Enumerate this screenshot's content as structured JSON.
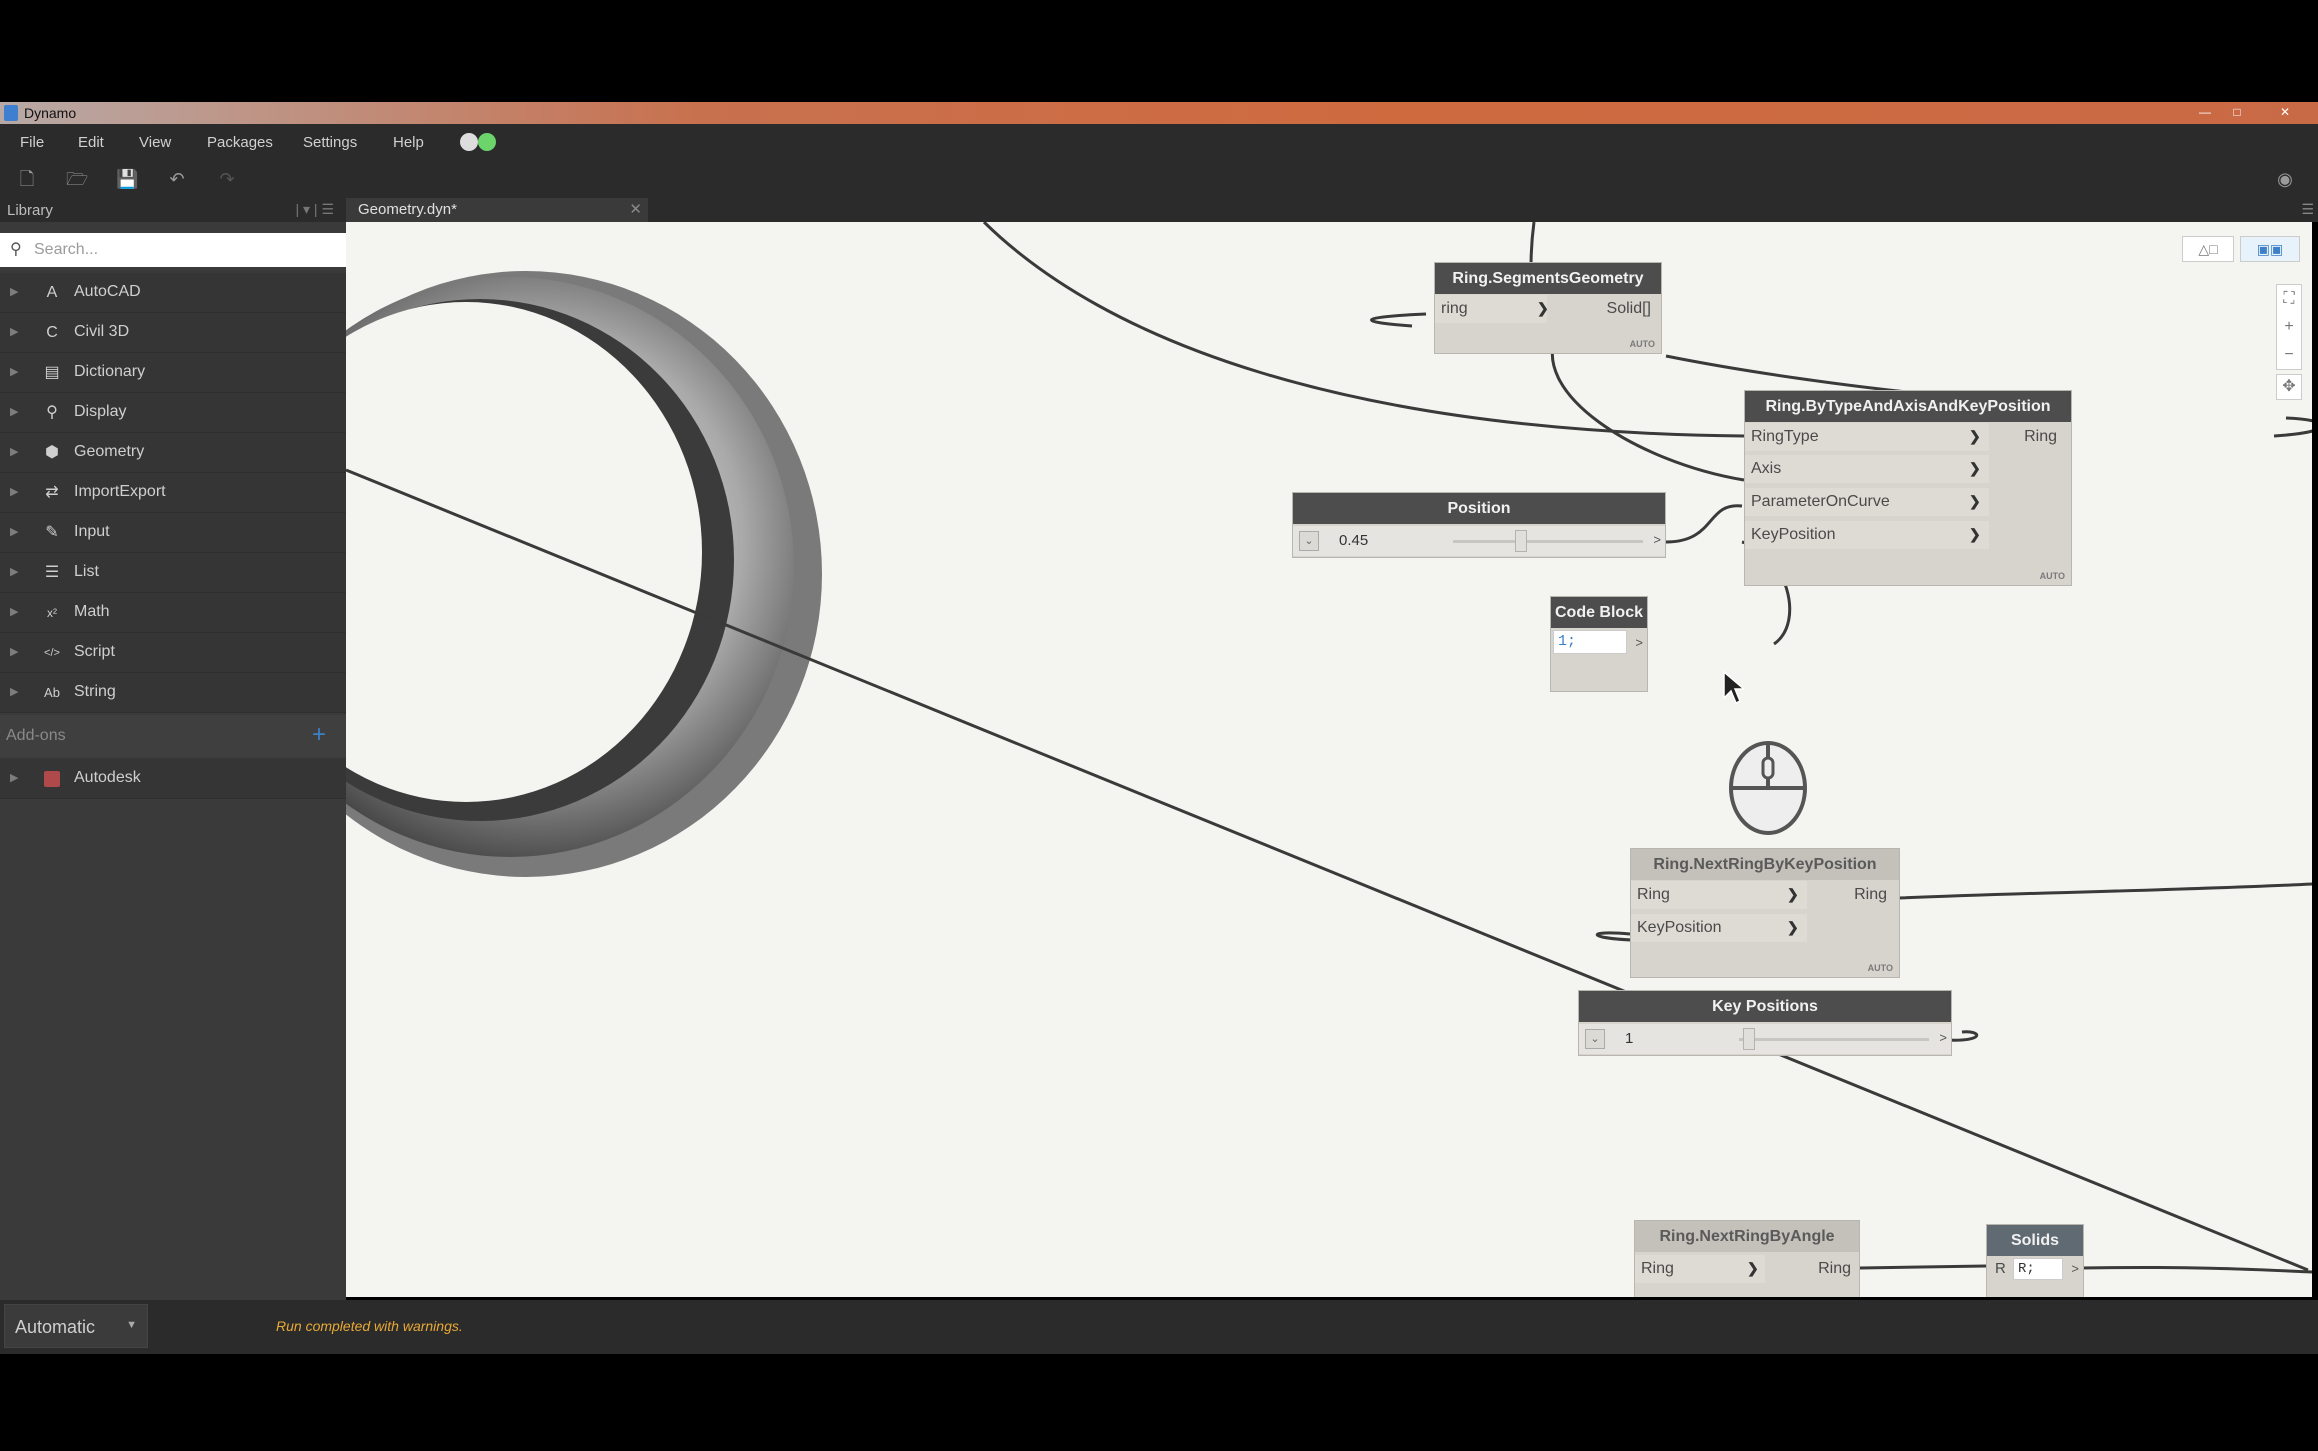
{
  "window": {
    "title": "Dynamo"
  },
  "menu": [
    "File",
    "Edit",
    "View",
    "Packages",
    "Settings",
    "Help"
  ],
  "library": {
    "title": "Library",
    "search_placeholder": "Search...",
    "categories": [
      {
        "label": "AutoCAD",
        "icon": "A"
      },
      {
        "label": "Civil 3D",
        "icon": "C"
      },
      {
        "label": "Dictionary",
        "icon": "▤"
      },
      {
        "label": "Display",
        "icon": "⚲"
      },
      {
        "label": "Geometry",
        "icon": "⬢"
      },
      {
        "label": "ImportExport",
        "icon": "⇄"
      },
      {
        "label": "Input",
        "icon": "✎"
      },
      {
        "label": "List",
        "icon": "☰"
      },
      {
        "label": "Math",
        "icon": "x²"
      },
      {
        "label": "Script",
        "icon": "</>"
      },
      {
        "label": "String",
        "icon": "Ab"
      }
    ],
    "addons_label": "Add-ons",
    "addon_items": [
      {
        "label": "Autodesk"
      }
    ]
  },
  "tab": {
    "label": "Geometry.dyn*"
  },
  "nodes": {
    "segments": {
      "title": "Ring.SegmentsGeometry",
      "in": "ring",
      "out": "Solid[]",
      "badge": "AUTO"
    },
    "bytype": {
      "title": "Ring.ByTypeAndAxisAndKeyPosition",
      "inputs": [
        "RingType",
        "Axis",
        "ParameterOnCurve",
        "KeyPosition"
      ],
      "out": "Ring",
      "badge": "AUTO"
    },
    "position": {
      "title": "Position",
      "value": "0.45",
      "out": ">",
      "fraction": 0.45
    },
    "codeblock": {
      "title": "Code Block",
      "code": "1;",
      "out": ">"
    },
    "nextkey": {
      "title": "Ring.NextRingByKeyPosition",
      "inputs": [
        "Ring",
        "KeyPosition"
      ],
      "out": "Ring",
      "badge": "AUTO"
    },
    "keypositions": {
      "title": "Key Positions",
      "value": "1",
      "out": ">"
    },
    "nextangle": {
      "title": "Ring.NextRingByAngle",
      "in": "Ring",
      "out": "Ring"
    },
    "solids": {
      "title": "Solids",
      "in": "R",
      "code": "R;",
      "out": ">"
    }
  },
  "statusbar": {
    "run_mode": "Automatic",
    "message": "Run completed with warnings."
  },
  "colors": {
    "warning": "#e8a935",
    "accent": "#3c80c6",
    "node_header": "#4d4d4d",
    "canvas": "#f4f4f1"
  }
}
